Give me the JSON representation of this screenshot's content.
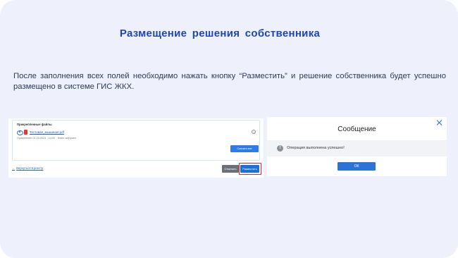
{
  "slide": {
    "title": "Размещение  решения  собственника",
    "body": "После заполнения всех полей необходимо нажать кнопку “Разместить” и решение собственника будет успешно размещено в системе ГИС ЖКХ."
  },
  "left_screenshot": {
    "files_title": "Прикрепленные файлы",
    "file_name": "Тестовая_мышиная.pdf",
    "file_meta": "Прикреплен 01.03.2024 · 14:02 · Файл загружен",
    "download_all": "Скачать все",
    "back_link_arrow": "←",
    "back_link": "Вернуться в реестр",
    "cancel": "Отменить",
    "publish": "Разместить"
  },
  "right_screenshot": {
    "title": "Сообщение",
    "info_glyph": "!",
    "message": "Операция выполнена успешно!",
    "ok": "ОК"
  },
  "colors": {
    "title": "#1f45b5",
    "background": "#eef1fb",
    "button_primary": "#2b74d6",
    "highlight": "#e0282a"
  },
  "icons": [
    "eye-icon",
    "pdf-icon",
    "settings-icon",
    "close-icon",
    "info-icon"
  ]
}
